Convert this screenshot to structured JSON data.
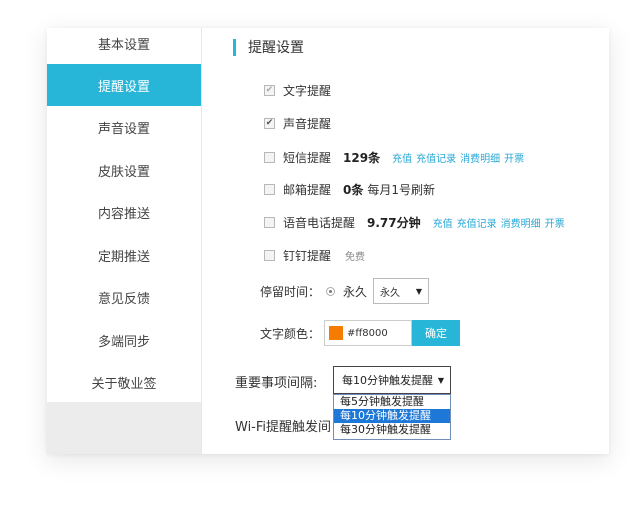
{
  "sidebar": {
    "items": [
      {
        "label": "基本设置"
      },
      {
        "label": "提醒设置"
      },
      {
        "label": "声音设置"
      },
      {
        "label": "皮肤设置"
      },
      {
        "label": "内容推送"
      },
      {
        "label": "定期推送"
      },
      {
        "label": "意见反馈"
      },
      {
        "label": "多端同步"
      },
      {
        "label": "关于敬业签"
      }
    ],
    "active_index": 1
  },
  "main": {
    "title": "提醒设置",
    "options": {
      "text_reminder": {
        "label": "文字提醒",
        "checked": true,
        "disabled": true
      },
      "sound_reminder": {
        "label": "声音提醒",
        "checked": true
      },
      "sms_reminder": {
        "label": "短信提醒",
        "value": "129条",
        "checked": false,
        "links": [
          "充值",
          "充值记录",
          "消费明细",
          "开票"
        ]
      },
      "email_reminder": {
        "label": "邮箱提醒",
        "value": "0条",
        "note": "每月1号刷新",
        "checked": false
      },
      "voice_call_reminder": {
        "label": "语音电话提醒",
        "value": "9.77分钟",
        "checked": false,
        "links": [
          "充值",
          "充值记录",
          "消费明细",
          "开票"
        ]
      },
      "dingtalk_reminder": {
        "label": "钉钉提醒",
        "note": "免费",
        "checked": false
      }
    },
    "stay_time": {
      "label": "停留时间：",
      "radio_label": "永久",
      "select_value": "永久"
    },
    "text_color": {
      "label": "文字颜色：",
      "value": "#ff8000",
      "swatch": "#f57c00",
      "confirm_label": "确定"
    },
    "interval": {
      "label": "重要事项间隔:",
      "selected": "每10分钟触发提醒",
      "options": [
        "每5分钟触发提醒",
        "每10分钟触发提醒",
        "每30分钟触发提醒"
      ]
    },
    "wifi": {
      "label": "Wi-Fi提醒触发间"
    }
  },
  "colors": {
    "accent": "#27b5d8",
    "link": "#27a8d6",
    "dropdown_highlight": "#1e78d7"
  }
}
